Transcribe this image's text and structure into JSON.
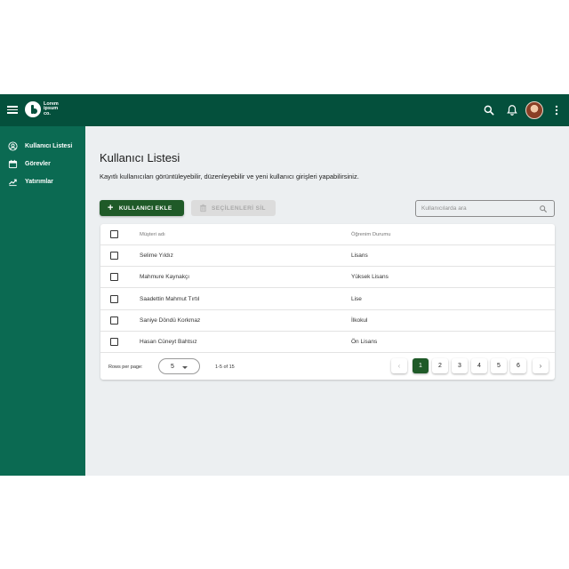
{
  "header": {
    "logo_lines": [
      "Lorem",
      "ipsum",
      "co."
    ],
    "icons": [
      "menu-icon",
      "search-icon",
      "bell-icon",
      "avatar",
      "more-vert-icon"
    ]
  },
  "sidebar": {
    "items": [
      {
        "label": "Kullanıcı Listesi",
        "icon": "user-circle-icon"
      },
      {
        "label": "Görevler",
        "icon": "calendar-icon"
      },
      {
        "label": "Yatırımlar",
        "icon": "trend-icon"
      }
    ]
  },
  "main": {
    "title": "Kullanıcı Listesi",
    "subtitle": "Kayıtlı kullanıcıları görüntüleyebilir, düzenleyebilir ve yeni kullanıcı girişleri yapabilirsiniz.",
    "add_button": "KULLANICI EKLE",
    "delete_button": "SEÇİLENLERİ SİL",
    "search_placeholder": "Kullanıcılarda ara"
  },
  "table": {
    "headers": {
      "name": "Müşteri adı",
      "status": "Öğrenim Durumu"
    },
    "rows": [
      {
        "name": "Selime Yıldız",
        "status": "Lisans"
      },
      {
        "name": "Mahmure Kaynakçı",
        "status": "Yüksek Lisans"
      },
      {
        "name": "Saadettin Mahmut Tırtıl",
        "status": "Lise"
      },
      {
        "name": "Saniye Döndü Korkmaz",
        "status": "İlkokul"
      },
      {
        "name": "Hasan Cüneyt Bahtsız",
        "status": "Ön Lisans"
      }
    ]
  },
  "pagination": {
    "rows_per_page_label": "Rows per page:",
    "rows_per_page_value": "5",
    "range": "1-5 of 15",
    "prev": "‹",
    "next": "›",
    "pages": [
      "1",
      "2",
      "3",
      "4",
      "5",
      "6"
    ],
    "current_page": "1"
  },
  "colors": {
    "topbar": "#04503c",
    "sidebar": "#0b6a52",
    "primary_button": "#1f5a28",
    "background": "#eceff1"
  }
}
